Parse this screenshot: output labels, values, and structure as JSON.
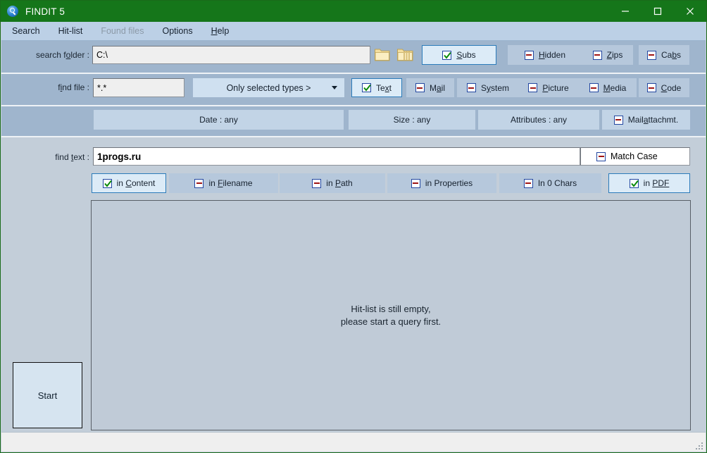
{
  "window": {
    "title": "FINDIT  5",
    "icon": "magnifier-icon",
    "minimize": "—",
    "maximize": "□",
    "close": "✕"
  },
  "menubar": {
    "items": [
      {
        "label": "Search",
        "accel": "",
        "disabled": false
      },
      {
        "label": "Hit-list",
        "accel": "",
        "disabled": false
      },
      {
        "label": "Found files",
        "accel": "",
        "disabled": true
      },
      {
        "label": "Options",
        "accel": "",
        "disabled": false
      },
      {
        "label": "Help",
        "accel": "H",
        "disabled": false
      }
    ]
  },
  "search_folder_row": {
    "label_pre": "search f",
    "label_accel": "o",
    "label_post": "lder :",
    "value": "C:\\",
    "placeholder": "",
    "browse_folder_icon": "folder-icon",
    "recent_folders_icon": "folder-stack-icon",
    "toggles": [
      {
        "name": "subs",
        "label": "Subs",
        "accel": "S",
        "state": "checked"
      },
      {
        "name": "hidden",
        "label": "Hidden",
        "accel": "H",
        "state": "minus"
      },
      {
        "name": "zips",
        "label": "Zips",
        "accel": "Z",
        "state": "minus"
      },
      {
        "name": "cabs",
        "label": "Cabs",
        "accel": "b",
        "state": "minus"
      }
    ]
  },
  "find_file_row": {
    "label_pre": "f",
    "label_accel": "i",
    "label_post": "nd file :",
    "value": "*.*",
    "types_combo": {
      "selected": "Only selected types >",
      "options": [
        "Only selected types >"
      ]
    },
    "toggles": [
      {
        "name": "text",
        "label_pre": "Te",
        "accel": "x",
        "label_post": "t",
        "state": "checked"
      },
      {
        "name": "mail",
        "label_pre": "M",
        "accel": "a",
        "label_post": "il",
        "state": "minus"
      },
      {
        "name": "system",
        "label_pre": "S",
        "accel": "y",
        "label_post": "stem",
        "state": "minus"
      },
      {
        "name": "picture",
        "label_pre": "",
        "accel": "P",
        "label_post": "icture",
        "state": "minus"
      },
      {
        "name": "media",
        "label_pre": "",
        "accel": "M",
        "label_post": "edia",
        "state": "minus"
      },
      {
        "name": "code",
        "label_pre": "",
        "accel": "C",
        "label_post": "ode",
        "state": "minus"
      }
    ]
  },
  "filters_row": {
    "date": "Date : any",
    "size": "Size : any",
    "attributes": "Attributes : any",
    "mail_attachment": {
      "label_pre": "Mail",
      "accel": "a",
      "label_post": "ttachmt.",
      "state": "minus"
    }
  },
  "find_text_row": {
    "label_pre": "find ",
    "label_accel": "t",
    "label_post": "ext :",
    "value": "1progs.ru",
    "match_case": {
      "label": "Match Case",
      "state": "minus"
    }
  },
  "scope_row": {
    "toggles": [
      {
        "name": "in-content",
        "label_pre": "in ",
        "accel": "C",
        "label_post": "ontent",
        "state": "checked"
      },
      {
        "name": "in-filename",
        "label_pre": "in ",
        "accel": "F",
        "label_post": "ilename",
        "state": "minus"
      },
      {
        "name": "in-path",
        "label_pre": "in ",
        "accel": "P",
        "label_post": "ath",
        "state": "minus"
      },
      {
        "name": "in-properties",
        "label_pre": "in Properties",
        "accel": "",
        "label_post": "",
        "state": "minus"
      },
      {
        "name": "in-0-chars",
        "label_pre": "In 0 Chars",
        "accel": "",
        "label_post": "",
        "state": "minus"
      },
      {
        "name": "in-pdf",
        "label_pre": "in ",
        "accel": "PDF",
        "label_post": "",
        "state": "checked"
      }
    ]
  },
  "hitlist": {
    "line1": "Hit-list is still empty,",
    "line2": "please start a query first."
  },
  "start_button": {
    "label": "Start"
  },
  "statusbar": {
    "text": ""
  },
  "colors": {
    "title_bar": "#15761a",
    "menu_bar": "#bcd0e6",
    "band_dark": "#9fb5cd",
    "band_light": "#c3ced9",
    "accent_border": "#2b7bba",
    "toggle_on_bg": "#dcebf7",
    "toggle_off_bg": "#b6c8dc",
    "check_green": "#0a8a0a",
    "minus_red": "#9e1414"
  }
}
